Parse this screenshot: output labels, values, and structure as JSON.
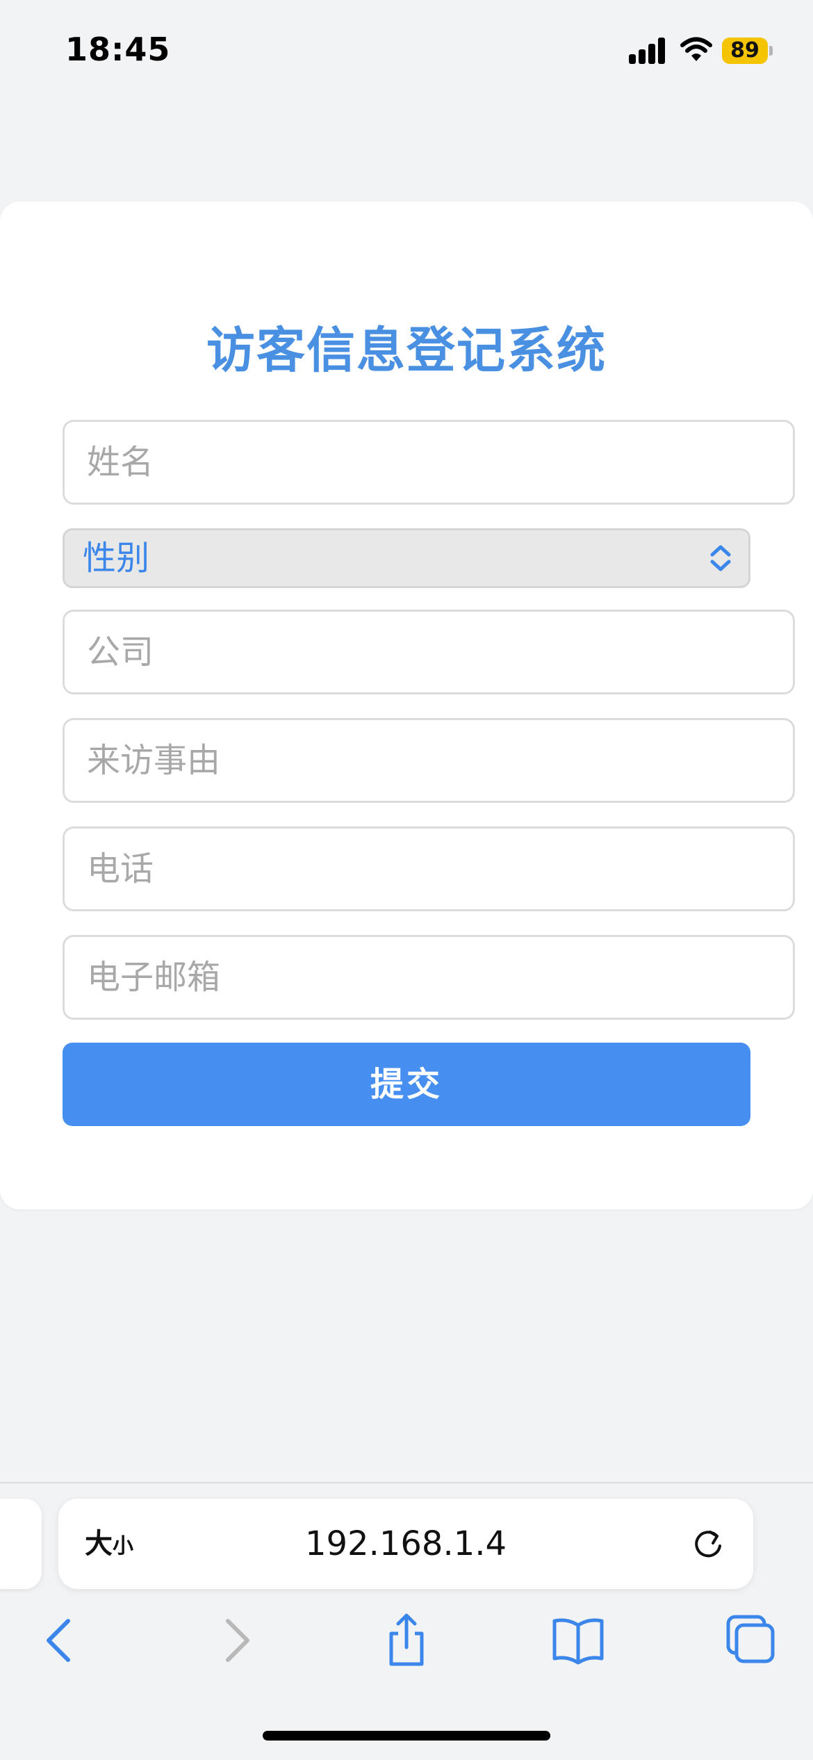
{
  "status_bar": {
    "time": "18:45",
    "battery_level": "89",
    "battery_color": "#f5c400"
  },
  "form": {
    "title": "访客信息登记系统",
    "name_placeholder": "姓名",
    "gender_label": "性别",
    "company_placeholder": "公司",
    "reason_placeholder": "来访事由",
    "phone_placeholder": "电话",
    "email_placeholder": "电子邮箱",
    "submit_label": "提交",
    "accent_color": "#468ef0"
  },
  "browser": {
    "text_size_label_big": "大",
    "text_size_label_small": "小",
    "url": "192.168.1.4",
    "icons": [
      "reload-icon",
      "back-icon",
      "forward-icon",
      "share-icon",
      "bookmarks-icon",
      "tabs-icon"
    ]
  }
}
